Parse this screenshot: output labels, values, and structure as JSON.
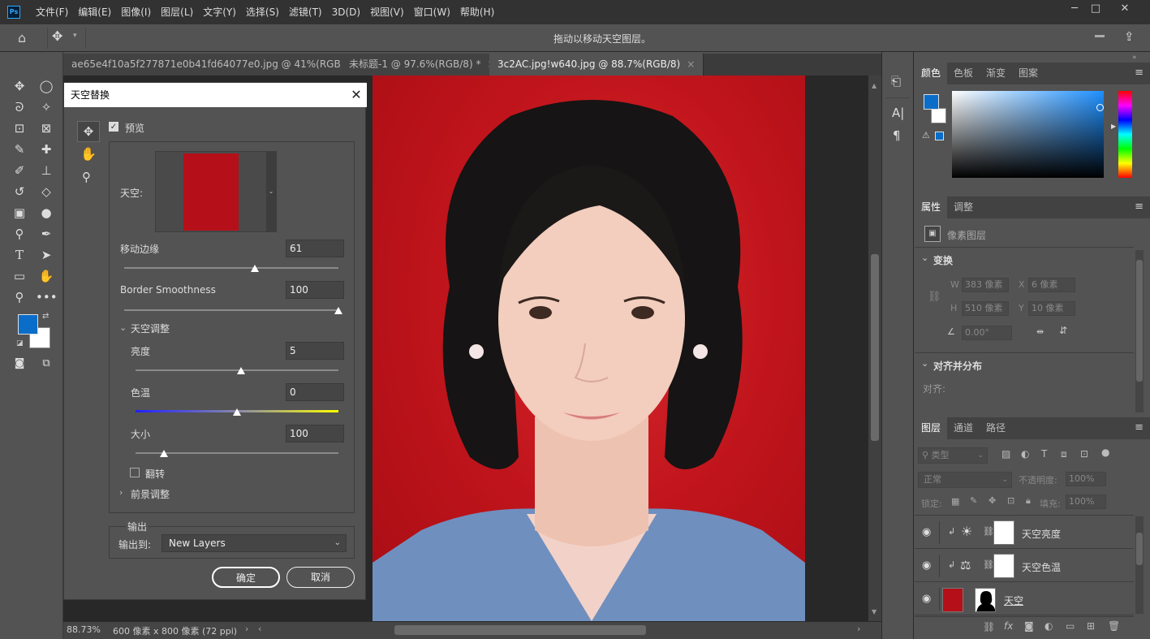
{
  "app": {
    "logo": "Ps"
  },
  "menu": [
    "文件(F)",
    "编辑(E)",
    "图像(I)",
    "图层(L)",
    "文字(Y)",
    "选择(S)",
    "滤镜(T)",
    "3D(D)",
    "视图(V)",
    "窗口(W)",
    "帮助(H)"
  ],
  "options_bar": {
    "hint": "拖动以移动天空图层。"
  },
  "doc_tabs": [
    {
      "label": "ae65e4f10a5f277871e0b41fd64077e0.jpg @ 41%(RGB/8#)",
      "active": false
    },
    {
      "label": "未标题-1 @ 97.6%(RGB/8) *",
      "active": false
    },
    {
      "label": "3c2AC.jpg!w640.jpg @ 88.7%(RGB/8)",
      "active": true
    }
  ],
  "status": {
    "zoom": "88.73%",
    "doc_info": "600 像素 x 800 像素 (72 ppi)"
  },
  "dialog": {
    "title": "天空替换",
    "preview_label": "预览",
    "sky_label": "天空:",
    "sky_color": "#b5101a",
    "move_edge": {
      "label": "移动边缘",
      "value": "61",
      "fraction": 0.61
    },
    "border_smoothness": {
      "label": "Border Smoothness",
      "value": "100",
      "fraction": 1.0
    },
    "sky_adjust_title": "天空调整",
    "brightness": {
      "label": "亮度",
      "value": "5",
      "fraction": 0.52
    },
    "temperature": {
      "label": "色温",
      "value": "0",
      "fraction": 0.5
    },
    "scale": {
      "label": "大小",
      "value": "100",
      "fraction": 0.14
    },
    "flip_label": "翻转",
    "foreground_title": "前景调整",
    "output_group": "输出",
    "output_to_label": "输出到:",
    "output_to_value": "New Layers",
    "ok": "确定",
    "cancel": "取消"
  },
  "color_panel": {
    "tabs": [
      "颜色",
      "色板",
      "渐变",
      "图案"
    ],
    "fg_color": "#0a6dc9",
    "bg_color": "#ffffff"
  },
  "properties_panel": {
    "tabs": [
      "属性",
      "调整"
    ],
    "layer_kind": "像素图层",
    "transform_title": "变换",
    "w_label": "W",
    "w_value": "383 像素",
    "h_label": "H",
    "h_value": "510 像素",
    "x_label": "X",
    "x_value": "6 像素",
    "y_label": "Y",
    "y_value": "10 像素",
    "angle_value": "0.00°",
    "align_title": "对齐并分布",
    "align_label": "对齐:"
  },
  "layers_panel": {
    "tabs": [
      "图层",
      "通道",
      "路径"
    ],
    "filter_kind": "类型",
    "blend_mode": "正常",
    "opacity_label": "不透明度:",
    "opacity_value": "100%",
    "lock_label": "锁定:",
    "fill_label": "填充:",
    "fill_value": "100%",
    "layers": [
      {
        "name": "天空亮度",
        "icon": "brightness-icon"
      },
      {
        "name": "天空色温",
        "icon": "balance-icon"
      },
      {
        "name": "天空",
        "icon": "pixel-layer"
      }
    ]
  }
}
